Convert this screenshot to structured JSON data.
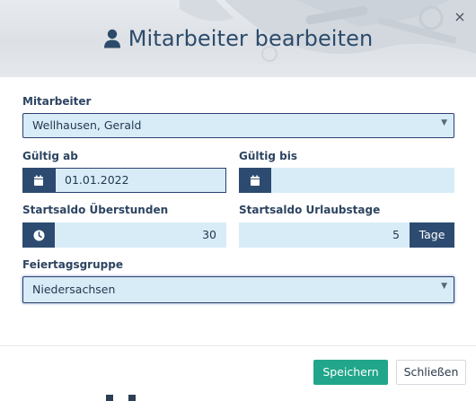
{
  "dialog": {
    "title": "Mitarbeiter bearbeiten",
    "close_symbol": "×",
    "title_icon": "user-icon"
  },
  "form": {
    "employee": {
      "label": "Mitarbeiter",
      "value": "Wellhausen, Gerald"
    },
    "valid_from": {
      "label": "Gültig ab",
      "value": "01.01.2022",
      "icon": "calendar-icon"
    },
    "valid_to": {
      "label": "Gültig bis",
      "value": "",
      "icon": "calendar-icon"
    },
    "overtime_start": {
      "label": "Startsaldo Überstunden",
      "value": "30",
      "icon": "clock-icon"
    },
    "vacation_start": {
      "label": "Startsaldo Urlaubstage",
      "value": "5",
      "unit": "Tage"
    },
    "holiday_group": {
      "label": "Feiertagsgruppe",
      "value": "Niedersachsen"
    }
  },
  "footer": {
    "save_label": "Speichern",
    "close_label": "Schließen"
  },
  "colors": {
    "accent_navy": "#2d4b70",
    "field_bg": "#d8ecf8",
    "primary_green": "#22a68b",
    "title_text": "#2c4b6b"
  }
}
